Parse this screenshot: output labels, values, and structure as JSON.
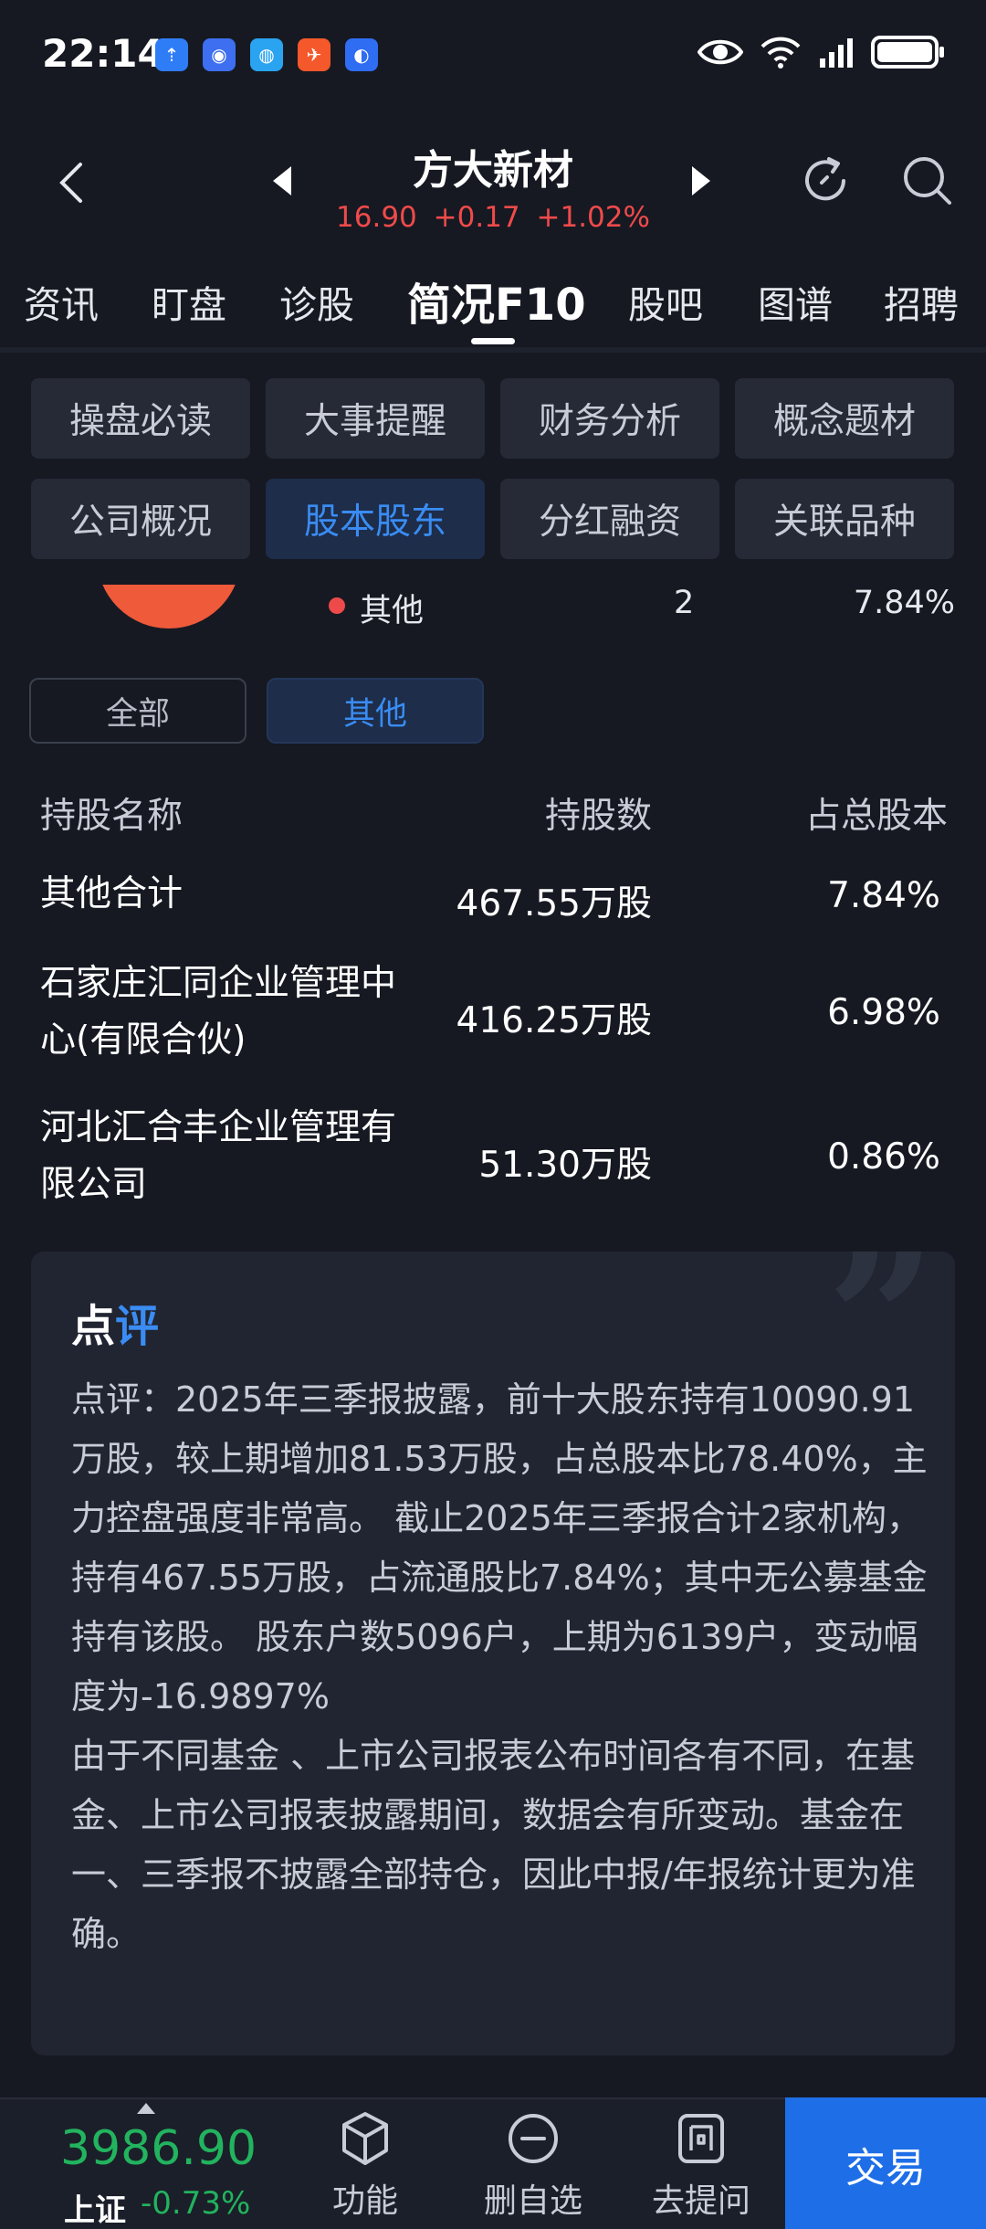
{
  "status_bar": {
    "time": "22:14",
    "app_icons": [
      {
        "name": "app-notification-1-icon",
        "color": "#2f7df6",
        "glyph": "⇡"
      },
      {
        "name": "app-notification-2-icon",
        "color": "#3d6ff0",
        "glyph": "◉"
      },
      {
        "name": "app-notification-3-icon",
        "color": "#2aa3f0",
        "glyph": "◍"
      },
      {
        "name": "app-notification-4-icon",
        "color": "#f5582a",
        "glyph": "✈"
      },
      {
        "name": "app-notification-5-icon",
        "color": "#2f6df2",
        "glyph": "◐"
      }
    ]
  },
  "header": {
    "stock_name": "方大新材",
    "price": "16.90",
    "change": "+0.17",
    "change_pct": "+1.02%",
    "price_color": "#f04a4a"
  },
  "top_tabs": [
    {
      "label": "资讯",
      "active": false
    },
    {
      "label": "盯盘",
      "active": false
    },
    {
      "label": "诊股",
      "active": false
    },
    {
      "label": "简况F10",
      "active": true
    },
    {
      "label": "股吧",
      "active": false
    },
    {
      "label": "图谱",
      "active": false
    },
    {
      "label": "招聘",
      "active": false
    }
  ],
  "sub_tabs": [
    {
      "label": "操盘必读",
      "active": false
    },
    {
      "label": "大事提醒",
      "active": false
    },
    {
      "label": "财务分析",
      "active": false
    },
    {
      "label": "概念题材",
      "active": false
    },
    {
      "label": "公司概况",
      "active": false
    },
    {
      "label": "股本股东",
      "active": true
    },
    {
      "label": "分红融资",
      "active": false
    },
    {
      "label": "关联品种",
      "active": false
    }
  ],
  "legend": {
    "name": "其他",
    "count": "2",
    "pct": "7.84%",
    "dot_color": "#ee4a4a"
  },
  "filters": {
    "all": "全部",
    "other": "其他"
  },
  "table": {
    "headers": {
      "name": "持股名称",
      "shares": "持股数",
      "pct": "占总股本"
    },
    "rows": [
      {
        "name": "其他合计",
        "shares": "467.55万股",
        "pct": "7.84%"
      },
      {
        "name": "石家庄汇同企业管理中心(有限合伙)",
        "shares": "416.25万股",
        "pct": "6.98%"
      },
      {
        "name": "河北汇合丰企业管理有限公司",
        "shares": "51.30万股",
        "pct": "0.86%"
      }
    ]
  },
  "comment": {
    "title_part1": "点",
    "title_part2": "评",
    "body": "点评：2025年三季报披露，前十大股东持有10090.91万股，较上期增加81.53万股，占总股本比78.40%，主力控盘强度非常高。 截止2025年三季报合计2家机构，持有467.55万股，占流通股比7.84%；其中无公募基金持有该股。 股东户数5096户，上期为6139户，变动幅度为-16.9897%\n由于不同基金 、上市公司报表公布时间各有不同，在基金、上市公司报表披露期间，数据会有所变动。基金在一、三季报不披露全部持仓，因此中报/年报统计更为准确。"
  },
  "bottom_bar": {
    "index_value": "3986.90",
    "index_name": "上证",
    "index_change": "-0.73%",
    "index_color": "#22b35e",
    "function_label": "功能",
    "remove_watch_label": "删自选",
    "ask_label": "去提问",
    "trade_label": "交易",
    "trade_color": "#1e6ee8"
  }
}
